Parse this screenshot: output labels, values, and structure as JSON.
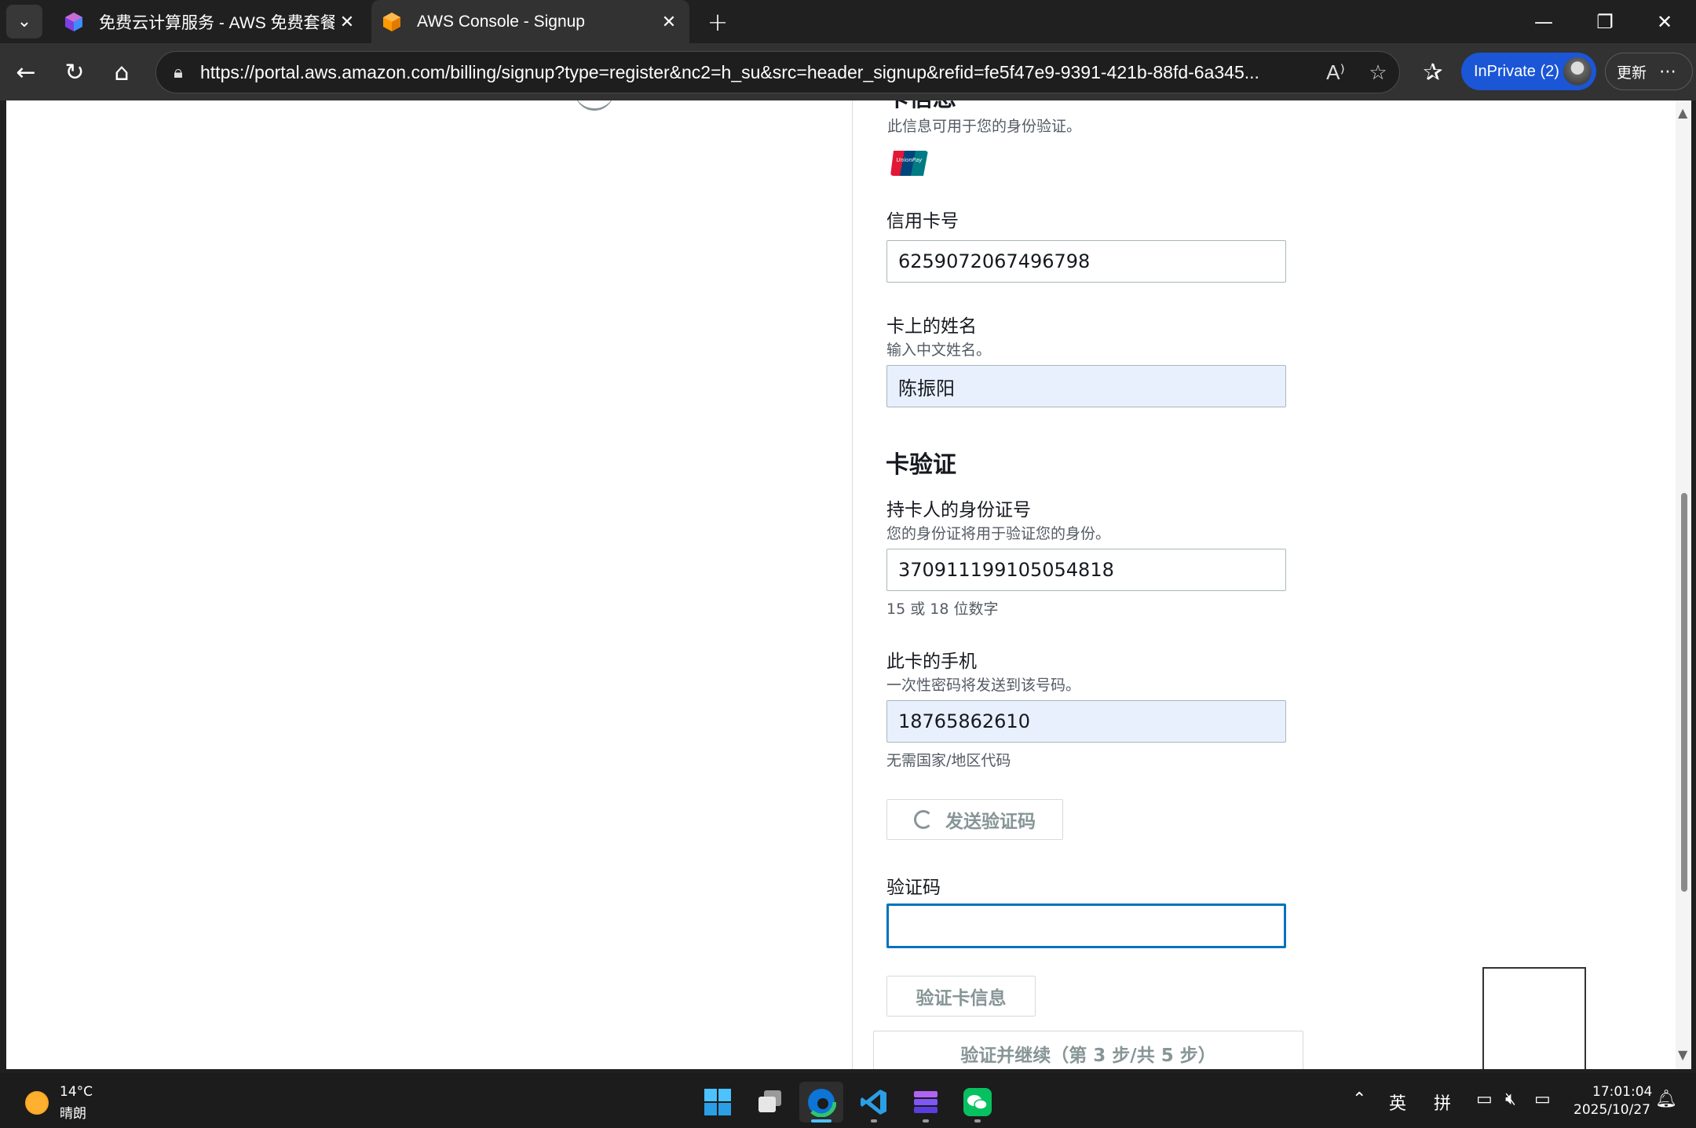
{
  "browser": {
    "tabs": [
      {
        "title": "免费云计算服务 - AWS 免费套餐",
        "active": false
      },
      {
        "title": "AWS Console - Signup",
        "active": true
      }
    ],
    "url": "https://portal.aws.amazon.com/billing/signup?type=register&nc2=h_su&src=header_signup&refid=fe5f47e9-9391-421b-88fd-6a345...",
    "inprivate_label": "InPrivate (2)",
    "update_label": "更新"
  },
  "form": {
    "section_title_partial": "卡信息",
    "section_hint": "此信息可用于您的身份验证。",
    "unionpay_text": "UnionPay",
    "card_number": {
      "label": "信用卡号",
      "value": "6259072067496798"
    },
    "card_name": {
      "label": "卡上的姓名",
      "hint": "输入中文姓名。",
      "value": "陈振阳"
    },
    "verify_heading": "卡验证",
    "id_number": {
      "label": "持卡人的身份证号",
      "hint": "您的身份证将用于验证您的身份。",
      "value": "370911199105054818",
      "note": "15 或 18 位数字"
    },
    "phone": {
      "label": "此卡的手机",
      "hint": "一次性密码将发送到该号码。",
      "value": "18765862610",
      "note": "无需国家/地区代码"
    },
    "send_code_button": "发送验证码",
    "otp": {
      "label": "验证码",
      "value": ""
    },
    "verify_card_button": "验证卡信息",
    "continue_button": "验证并继续（第 3 步/共 5 步）"
  },
  "taskbar": {
    "weather_temp": "14°C",
    "weather_desc": "晴朗",
    "ime_lang": "英",
    "ime_mode": "拼",
    "time": "17:01:04",
    "date": "2025/10/27"
  },
  "colors": {
    "primary_blue": "#0073bb",
    "autofill_bg": "#e8f0fe",
    "inprivate_blue": "#1a56d6",
    "aws_orange": "#ff9900"
  }
}
